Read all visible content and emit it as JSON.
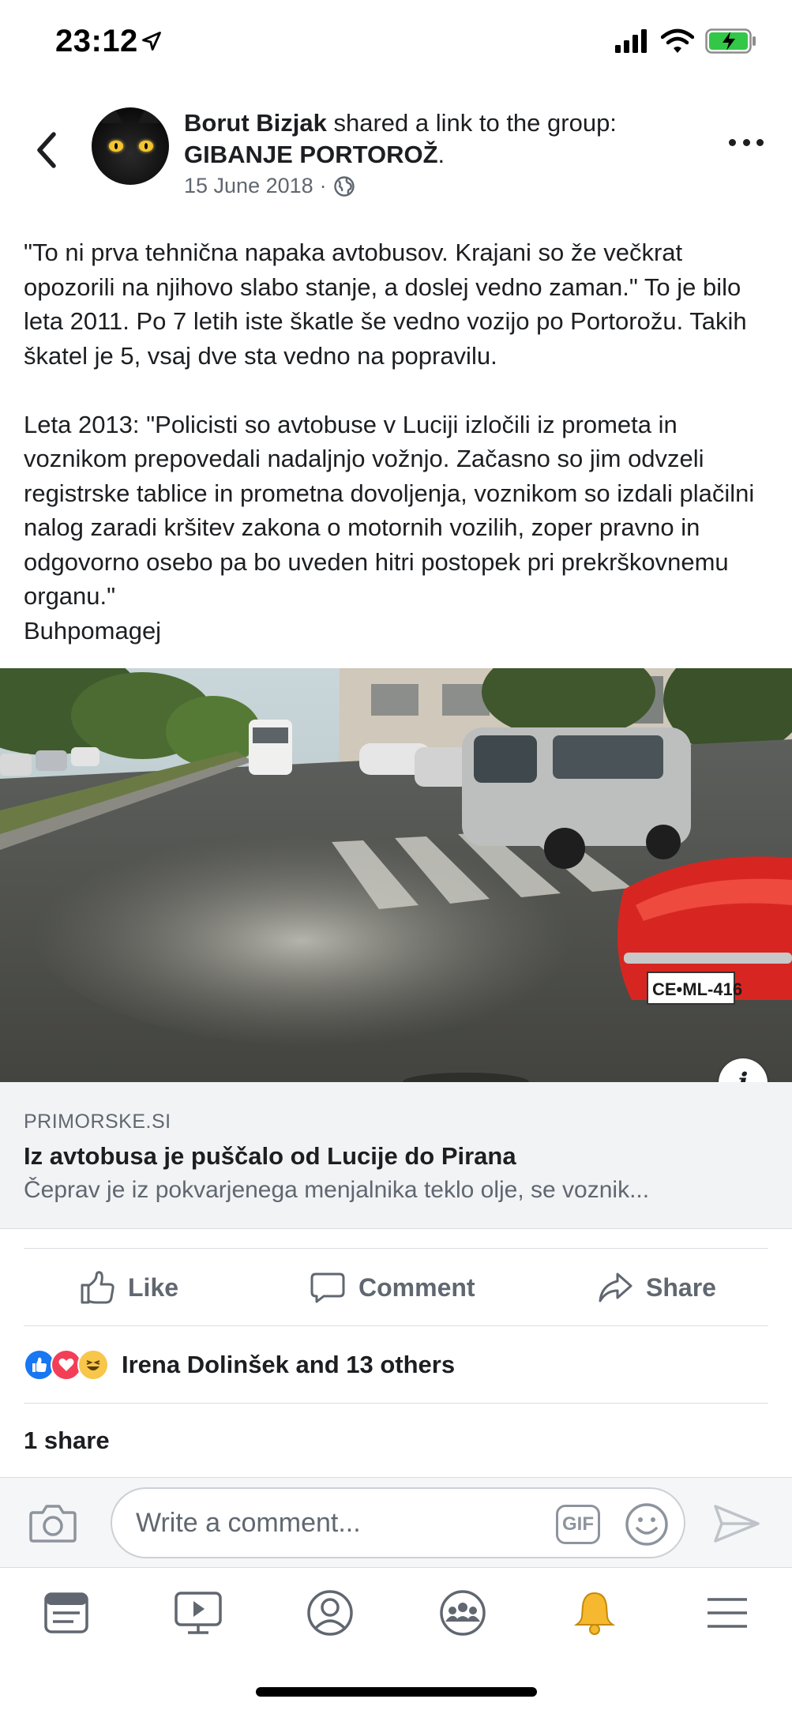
{
  "status_bar": {
    "time": "23:12"
  },
  "post": {
    "author": "Borut Bizjak",
    "shared_text": " shared a link to the group: ",
    "group": "GIBANJE PORTOROŽ",
    "group_suffix": ".",
    "date": "15 June 2018",
    "date_separator": "·",
    "text": "\"To ni prva tehnična napaka avtobusov. Krajani so že večkrat opozorili na njihovo slabo stanje, a doslej vedno zaman.\" To je bilo leta 2011. Po 7 letih iste škatle še vedno vozijo po Portorožu. Takih škatel je 5, vsaj dve sta vedno na popravilu.\n\nLeta 2013: \"Policisti so avtobuse v Luciji izločili iz prometa in voznikom prepovedali nadaljnjo vožnjo. Začasno so jim odvzeli registrske tablice in prometna dovoljenja, voznikom so izdali plačilni nalog zaradi kršitev zakona o motornih vozilih, zoper pravno in odgovorno osebo pa bo uveden hitri postopek pri prekrškovnemu organu.\"\nBuhpomagej"
  },
  "link": {
    "image_plate": "CE•ML-416",
    "domain": "PRIMORSKE.SI",
    "title": "Iz avtobusa je puščalo od Lucije do Pirana",
    "description": "Čeprav je iz pokvarjenega menjalnika teklo olje, se voznik..."
  },
  "actions": {
    "like": "Like",
    "comment": "Comment",
    "share": "Share"
  },
  "reactions": {
    "summary": "Irena Dolinšek and 13 others"
  },
  "shares": {
    "count_text": "1 share"
  },
  "comment_bar": {
    "placeholder": "Write a comment...",
    "gif_label": "GIF"
  },
  "colors": {
    "brand_blue": "#1877f2",
    "text_primary": "#1c1e21",
    "text_secondary": "#606770",
    "love_red": "#f33e58",
    "haha_yellow": "#f7c64a",
    "notification_gold": "#f5b82e"
  },
  "icons": {
    "status": [
      "location-arrow-icon",
      "cellular-signal-icon",
      "wifi-icon",
      "battery-charging-icon"
    ],
    "header": [
      "back-chevron-icon",
      "globe-icon",
      "more-dots-icon"
    ],
    "actions": [
      "thumbs-up-icon",
      "comment-bubble-icon",
      "share-arrow-icon"
    ],
    "comment_bar": [
      "camera-icon",
      "gif-icon",
      "emoji-icon",
      "send-icon"
    ],
    "tabs": [
      "news-feed-icon",
      "watch-video-icon",
      "profile-icon",
      "groups-icon",
      "notifications-bell-icon",
      "menu-icon"
    ]
  }
}
